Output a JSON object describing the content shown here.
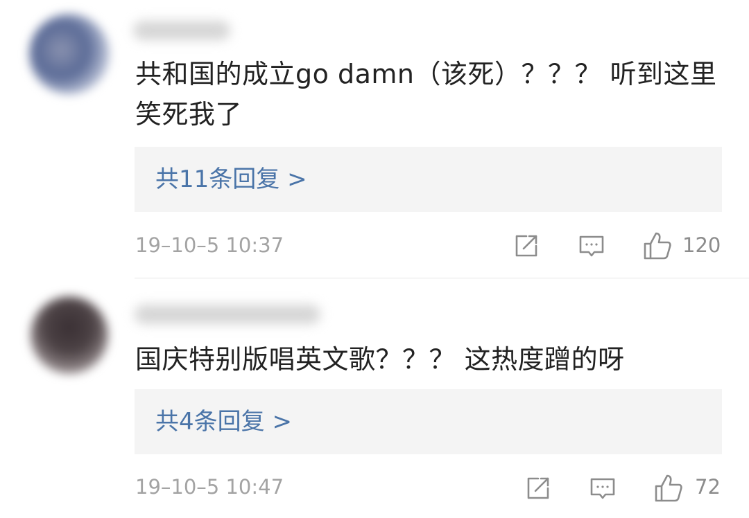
{
  "comments": [
    {
      "text": "共和国的成立go damn（该死）？？？ 听到这里笑死我了",
      "replies_label": "共11条回复 >",
      "timestamp": "19–10–5 10:37",
      "likes": "120"
    },
    {
      "text": "国庆特别版唱英文歌？？？ 这热度蹭的呀",
      "replies_label": "共4条回复 >",
      "timestamp": "19–10–5 10:47",
      "likes": "72"
    }
  ],
  "colors": {
    "link": "#4a74a8",
    "meta": "#a3a3a3",
    "icon": "#8c8c8c",
    "reply_box": "#f4f4f4"
  },
  "icons": [
    "share-icon",
    "comment-icon",
    "thumbs-up-icon"
  ]
}
